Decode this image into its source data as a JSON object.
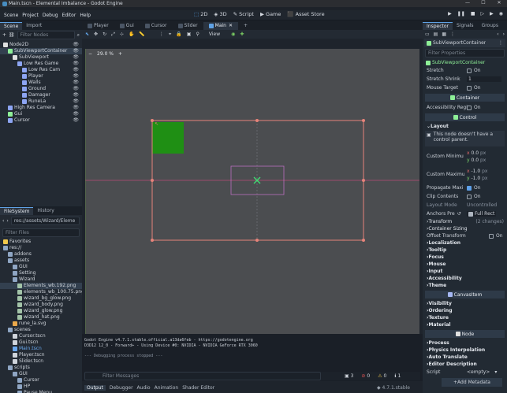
{
  "window": {
    "title": "Main.tscn - Elemental Imbalance - Godot Engine"
  },
  "menu": [
    "Scene",
    "Project",
    "Debug",
    "Editor",
    "Help"
  ],
  "modes": [
    {
      "label": "2D",
      "active": true
    },
    {
      "label": "3D",
      "active": false
    },
    {
      "label": "Script",
      "active": false
    },
    {
      "label": "Game",
      "active": false
    },
    {
      "label": "Asset Store",
      "active": false
    }
  ],
  "scene_dock": {
    "tabs": [
      "Scene",
      "Import"
    ],
    "filter_placeholder": "Filter Nodes",
    "nodes": [
      {
        "label": "Node2D",
        "indent": 0,
        "color": "#e0e0e0"
      },
      {
        "label": "SubViewportContainer",
        "indent": 1,
        "color": "#8eef97",
        "selected": true
      },
      {
        "label": "SubViewport",
        "indent": 2,
        "color": "#e0e0e0"
      },
      {
        "label": "Low Res Game",
        "indent": 3,
        "color": "#8da5f3"
      },
      {
        "label": "Low Res Cam",
        "indent": 4,
        "color": "#8da5f3"
      },
      {
        "label": "Player",
        "indent": 4,
        "color": "#8da5f3"
      },
      {
        "label": "Walls",
        "indent": 4,
        "color": "#8da5f3"
      },
      {
        "label": "Ground",
        "indent": 4,
        "color": "#8da5f3"
      },
      {
        "label": "Damager",
        "indent": 4,
        "color": "#8da5f3"
      },
      {
        "label": "RuneLa",
        "indent": 4,
        "color": "#8da5f3"
      },
      {
        "label": "High Res Camera",
        "indent": 1,
        "color": "#8da5f3"
      },
      {
        "label": "Gui",
        "indent": 1,
        "color": "#8eef97"
      },
      {
        "label": "Cursor",
        "indent": 1,
        "color": "#8da5f3"
      }
    ]
  },
  "filesystem_dock": {
    "tabs": [
      "FileSystem",
      "History"
    ],
    "path": "res://assets/Wizard/Eleme",
    "filter_placeholder": "Filter Files",
    "items": [
      {
        "label": "Favorites",
        "indent": 0,
        "color": "#f2c94c"
      },
      {
        "label": "res://",
        "indent": 0,
        "color": "#8fa6c4"
      },
      {
        "label": "addons",
        "indent": 1,
        "color": "#8fa6c4"
      },
      {
        "label": "assets",
        "indent": 1,
        "color": "#8fa6c4"
      },
      {
        "label": "GUI",
        "indent": 2,
        "color": "#8fa6c4"
      },
      {
        "label": "Setting",
        "indent": 2,
        "color": "#8fa6c4"
      },
      {
        "label": "Wizard",
        "indent": 2,
        "color": "#8fa6c4"
      },
      {
        "label": "Elements_wb.192.png",
        "indent": 3,
        "color": "#a3c4a8",
        "selected": true
      },
      {
        "label": "elements_wb_100.75.png",
        "indent": 3,
        "color": "#a3c4a8"
      },
      {
        "label": "wizard_bg_glow.png",
        "indent": 3,
        "color": "#a3c4a8"
      },
      {
        "label": "wizard_body.png",
        "indent": 3,
        "color": "#a3c4a8"
      },
      {
        "label": "wizard_glow.png",
        "indent": 3,
        "color": "#a3c4a8"
      },
      {
        "label": "wizard_hat.png",
        "indent": 3,
        "color": "#a3c4a8"
      },
      {
        "label": "rune_la.svg",
        "indent": 2,
        "color": "#e9a84b"
      },
      {
        "label": "scenes",
        "indent": 1,
        "color": "#8fa6c4"
      },
      {
        "label": "Cursor.tscn",
        "indent": 2,
        "color": "#cfd4db"
      },
      {
        "label": "Gui.tscn",
        "indent": 2,
        "color": "#cfd4db"
      },
      {
        "label": "Main.tscn",
        "indent": 2,
        "color": "#6aa9f0"
      },
      {
        "label": "Player.tscn",
        "indent": 2,
        "color": "#cfd4db"
      },
      {
        "label": "Slider.tscn",
        "indent": 2,
        "color": "#cfd4db"
      },
      {
        "label": "scripts",
        "indent": 1,
        "color": "#8fa6c4"
      },
      {
        "label": "GUI",
        "indent": 2,
        "color": "#8fa6c4"
      },
      {
        "label": "Cursor",
        "indent": 3,
        "color": "#8fa6c4"
      },
      {
        "label": "HP",
        "indent": 3,
        "color": "#8fa6c4"
      },
      {
        "label": "Pause Menu",
        "indent": 3,
        "color": "#8fa6c4"
      }
    ]
  },
  "doc_tabs": [
    {
      "label": "Player",
      "active": false
    },
    {
      "label": "Gui",
      "active": false
    },
    {
      "label": "Cursor",
      "active": false
    },
    {
      "label": "Slider",
      "active": false
    },
    {
      "label": "Main",
      "active": true
    }
  ],
  "viewport": {
    "view_label": "View",
    "zoom": "29.0 %"
  },
  "console": {
    "lines": [
      "Godot Engine v4.7.1.stable.official.a13da6feb - https://godotengine.org",
      "D3D12 12_0 - Forward+ - Using Device #0: NVIDIA - NVIDIA GeForce RTX 3060",
      "",
      "--- Debugging process stopped ---"
    ],
    "filter_placeholder": "Filter Messages",
    "counts": [
      "3",
      "0",
      "0",
      "1"
    ]
  },
  "bottom_tabs": [
    {
      "label": "Output",
      "active": true
    },
    {
      "label": "Debugger",
      "active": false
    },
    {
      "label": "Audio",
      "active": false
    },
    {
      "label": "Animation",
      "active": false
    },
    {
      "label": "Shader Editor",
      "active": false
    }
  ],
  "version": "4.7.1.stable",
  "inspector": {
    "tabs": [
      "Inspector",
      "Signals",
      "Groups"
    ],
    "node_name": "SubViewportContainer",
    "filter_placeholder": "Filter Properties",
    "class_name": "SubViewportContainer",
    "stretch": {
      "label": "Stretch",
      "value": "On"
    },
    "stretch_shrink": {
      "label": "Stretch Shrink",
      "value": "1"
    },
    "mouse_target": {
      "label": "Mouse Target",
      "value": "On"
    },
    "container_header": "Container",
    "accessibility": {
      "label": "Accessibility Regi",
      "value": "On"
    },
    "control_header": "Control",
    "layout_section": "Layout",
    "layout_warning": "This node doesn't have a control parent.",
    "custom_minimum": {
      "label": "Custom Minimu",
      "x": "0.0",
      "y": "0.0",
      "unit": "px"
    },
    "custom_maximum": {
      "label": "Custom Maximu",
      "x": "-1.0",
      "y": "-1.0",
      "unit": "px"
    },
    "propagate": {
      "label": "Propagate Maxi",
      "value": "On"
    },
    "clip_contents": {
      "label": "Clip Contents",
      "value": "On"
    },
    "layout_mode": {
      "label": "Layout Mode",
      "value": "Uncontrolled"
    },
    "anchors_preset": {
      "label": "Anchors Pre",
      "value": "Full Rect"
    },
    "transform": {
      "label": "Transform",
      "value": "(2 changes)"
    },
    "container_sizing": "Container Sizing",
    "offset_transform": {
      "label": "Offset Transform",
      "value": "On"
    },
    "control_sections": [
      "Localization",
      "Tooltip",
      "Focus",
      "Mouse",
      "Input",
      "Accessibility",
      "Theme"
    ],
    "canvasitem_header": "CanvasItem",
    "canvas_sections": [
      "Visibility",
      "Ordering",
      "Texture",
      "Material"
    ],
    "node_header": "Node",
    "node_sections": [
      "Process",
      "Physics Interpolation",
      "Auto Translate",
      "Editor Description"
    ],
    "script": {
      "label": "Script",
      "value": "<empty>"
    },
    "add_metadata": "Add Metadata"
  },
  "colors": {
    "accent": "#5fa2e5",
    "selection_rect": "#e6837a",
    "green_sprite": "#1f8f14"
  }
}
